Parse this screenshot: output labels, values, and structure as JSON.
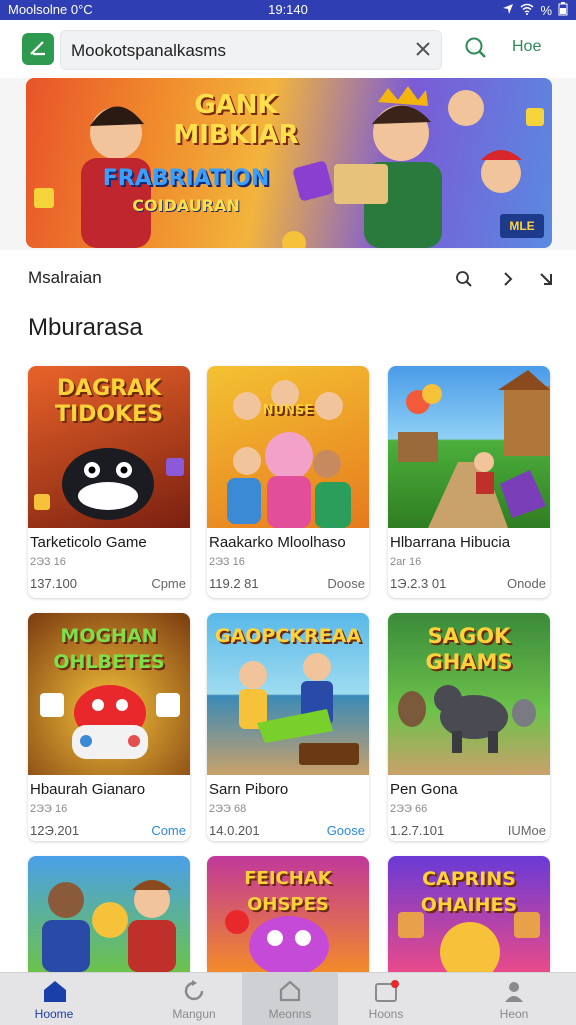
{
  "status_bar": {
    "left": "Moolsolne  0°C",
    "time": "19:140",
    "battery": "%"
  },
  "header": {
    "search_value": "Mookotspanalkasms",
    "home_label": "Hoe"
  },
  "banner": {
    "title": "GANK MIBKIAR",
    "subtitle": "FRABRIATION",
    "caption": "COIDAURAN",
    "badge": "MLE"
  },
  "section_nav": {
    "label": "Msalraian"
  },
  "section_heading": "Mburarasa",
  "games": [
    {
      "thumb_title": "DAGRAK TIDOKES",
      "name": "Tarketicolo Game",
      "meta": "2ЭЗ 16",
      "count": "137.100",
      "tag": "Cpme"
    },
    {
      "thumb_title": "NUNSE",
      "name": "Raakarko Mloolhaso",
      "meta": "2ЭЗ 16",
      "count": "119.2 81",
      "tag": "Doose"
    },
    {
      "thumb_title": "",
      "name": "Hlbarrana Hibucia",
      "meta": "2ar 16",
      "count": "1Э.2.3 01",
      "tag": "Onode"
    },
    {
      "thumb_title": "MOGHAN OHLBETES",
      "name": "Hbaurah Gianaro",
      "meta": "2ЭЭ 16",
      "count": "12Э.201",
      "tag": "Come"
    },
    {
      "thumb_title": "GAOPCKREAA",
      "name": "Sarn Piboro",
      "meta": "2ЭЭ 68",
      "count": "14.0.201",
      "tag": "Goose"
    },
    {
      "thumb_title": "SAGOK GHAMS",
      "name": "Pen Gona",
      "meta": "2ЭЭ 66",
      "count": "1.2.7.101",
      "tag": "IUMoe"
    },
    {
      "thumb_title": "",
      "name": "",
      "meta": "",
      "count": "",
      "tag": ""
    },
    {
      "thumb_title": "FEICHAK OHSPES",
      "name": "",
      "meta": "",
      "count": "",
      "tag": ""
    },
    {
      "thumb_title": "CAPRINS OHAIHES",
      "name": "",
      "meta": "",
      "count": "",
      "tag": ""
    }
  ],
  "bottom_nav": [
    {
      "label": "Hoome"
    },
    {
      "label": "Mangun"
    },
    {
      "label": "Meonns"
    },
    {
      "label": "Hoons"
    },
    {
      "label": "Heon"
    }
  ],
  "colors": {
    "status_bar": "#2f3fb3",
    "brand_green": "#2e9a4f",
    "accent_blue": "#2b8bd6",
    "nav_active": "#1b3fa8"
  }
}
